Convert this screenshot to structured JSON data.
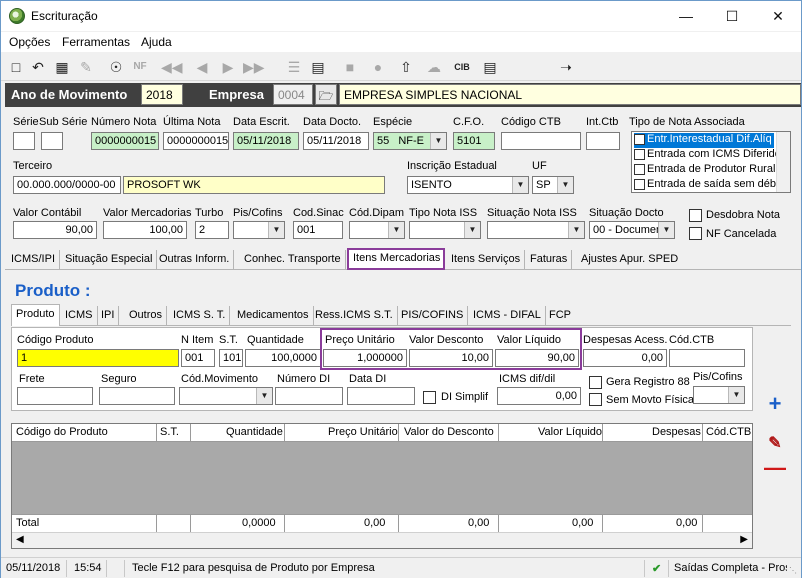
{
  "window": {
    "title": "Escrituração"
  },
  "menu": [
    "Opções",
    "Ferramentas",
    "Ajuda"
  ],
  "toolbar_icons": [
    "new-doc-icon",
    "undo-icon",
    "save-icon",
    "delete-icon",
    "print-preview-icon",
    "nfe-icon",
    "first-icon",
    "prev-icon",
    "next-icon",
    "last-icon",
    "tree-icon",
    "calc-icon",
    "folder-icon",
    "apple-icon",
    "upload-icon",
    "cloud-icon",
    "cib-icon",
    "notes-icon",
    "exit-icon"
  ],
  "band": {
    "ano_label": "Ano de Movimento",
    "ano_value": "2018",
    "empresa_label": "Empresa",
    "empresa_code": "0004",
    "empresa_name": "EMPRESA SIMPLES NACIONAL"
  },
  "header": {
    "serie_label": "Série",
    "subserie_label": "Sub Série",
    "numero_nota_label": "Número Nota",
    "numero_nota": "0000000015",
    "ultima_nota_label": "Última Nota",
    "ultima_nota": "0000000015",
    "data_escrit_label": "Data Escrit.",
    "data_escrit": "05/11/2018",
    "data_docto_label": "Data Docto.",
    "data_docto": "05/11/2018",
    "especie_label": "Espécie",
    "especie_code": "55",
    "especie_name": "NF-E",
    "cfo_label": "C.F.O.",
    "cfo": "5101",
    "codigo_ctb_label": "Código CTB",
    "int_ctb_label": "Int.Ctb",
    "tipo_nota_label": "Tipo de Nota Associada",
    "tipo_nota_items": [
      "Entr.Interestadual Dif.Alíq",
      "Entrada com ICMS Diferido",
      "Entrada de Produtor Rural",
      "Entrada de saída sem débi"
    ],
    "terceiro_label": "Terceiro",
    "terceiro_doc": "00.000.000/0000-00",
    "terceiro_name": "PROSOFT WK",
    "inscricao_label": "Inscrição Estadual",
    "inscricao": "ISENTO",
    "uf_label": "UF",
    "uf": "SP",
    "valor_contabil_label": "Valor Contábil",
    "valor_contabil": "90,00",
    "valor_merc_label": "Valor Mercadorias",
    "valor_merc": "100,00",
    "turbo_label": "Turbo",
    "turbo": "2",
    "pis_cofins_label": "Pis/Cofins",
    "cod_sinac_label": "Cod.Sinac",
    "cod_sinac": "001",
    "cod_dipam_label": "Cód.Dipam",
    "tipo_iss_label": "Tipo Nota ISS",
    "sit_iss_label": "Situação Nota ISS",
    "sit_docto_label": "Situação Docto",
    "sit_docto": "00 - Documen",
    "desdobra_label": "Desdobra Nota",
    "nf_cancelada_label": "NF Cancelada"
  },
  "main_tabs": [
    "ICMS/IPI",
    "Situação Especial",
    "Outras Inform.",
    "Conhec. Transporte",
    "Itens Mercadorias",
    "Itens Serviços",
    "Faturas",
    "Ajustes Apur. SPED"
  ],
  "produto_title": "Produto :",
  "sub_tabs": [
    "Produto",
    "ICMS",
    "IPI",
    "Outros",
    "ICMS S. T.",
    "Medicamentos",
    "Ress.ICMS S.T.",
    "PIS/COFINS",
    "ICMS - DIFAL",
    "FCP"
  ],
  "produto": {
    "codigo_label": "Código Produto",
    "codigo": "1",
    "nitem_label": "N Item",
    "nitem": "001",
    "st_label": "S.T.",
    "st": "101",
    "quantidade_label": "Quantidade",
    "quantidade": "100,0000",
    "preco_label": "Preço Unitário",
    "preco": "1,000000",
    "desconto_label": "Valor Desconto",
    "desconto": "10,00",
    "liquido_label": "Valor Líquido",
    "liquido": "90,00",
    "despesas_label": "Despesas Acess.",
    "despesas": "0,00",
    "cod_ctb_label": "Cód.CTB",
    "frete_label": "Frete",
    "seguro_label": "Seguro",
    "cod_mov_label": "Cód.Movimento",
    "numero_di_label": "Número DI",
    "data_di_label": "Data DI",
    "di_simplif_label": "DI Simplif",
    "icms_difal_label": "ICMS dif/dil",
    "icms_difal": "0,00",
    "gera_registro_label": "Gera Registro 88",
    "sem_movto_label": "Sem Movto Física",
    "pis_cofins_label": "Pis/Cofins"
  },
  "grid": {
    "columns": [
      "Código do Produto",
      "S.T.",
      "Quantidade",
      "Preço Unitário",
      "Valor do Desconto",
      "Valor Líquido",
      "Despesas",
      "Cód.CTB"
    ],
    "total_label": "Total",
    "totals": [
      "0,0000",
      "0,00",
      "0,00",
      "0,00",
      "0,00"
    ]
  },
  "status": {
    "date": "05/11/2018",
    "time": "15:54",
    "hint": "Tecle F12 para pesquisa de Produto por Empresa",
    "mode": "Saídas Completa - Pros"
  }
}
